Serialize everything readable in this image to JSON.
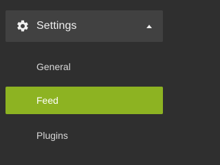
{
  "menu": {
    "title": "Settings",
    "icon": "gear-icon",
    "expand_indicator": "caret-up-icon",
    "items": [
      {
        "label": "General",
        "active": false
      },
      {
        "label": "Feed",
        "active": true
      },
      {
        "label": "Plugins",
        "active": false
      }
    ]
  },
  "colors": {
    "background": "#2f2f2f",
    "header_background": "#414141",
    "accent": "#8db322",
    "text": "#e6e6e6"
  }
}
